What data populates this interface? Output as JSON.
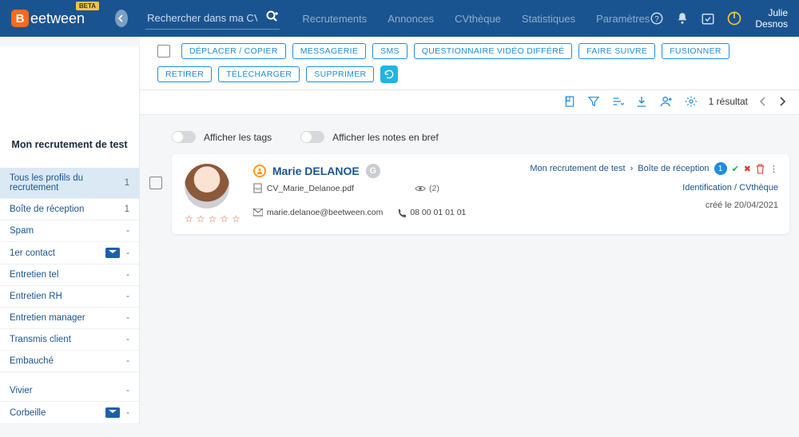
{
  "brand": {
    "word": "eetween",
    "badge_letter": "B",
    "beta": "BETA"
  },
  "search": {
    "placeholder": "Rechercher dans ma CVthèque"
  },
  "nav": {
    "recrut": "Recrutements",
    "annonces": "Annonces",
    "cv": "CVthèque",
    "stats": "Statistiques",
    "params": "Paramètres"
  },
  "user": {
    "first": "Julie",
    "last": "Desnos"
  },
  "actions": {
    "deplacer": "DÉPLACER / COPIER",
    "messagerie": "MESSAGERIE",
    "sms": "SMS",
    "questionnaire": "QUESTIONNAIRE VIDÉO DIFFÉRÉ",
    "suivre": "FAIRE SUIVRE",
    "fusionner": "FUSIONNER",
    "retirer": "RETIRER",
    "telecharger": "TÉLÉCHARGER",
    "supprimer": "SUPPRIMER"
  },
  "resultcount": "1 résultat",
  "sidebar": {
    "title": "Mon recrutement de test",
    "all": {
      "label": "Tous les profils du recrutement",
      "count": "1"
    },
    "inbox": {
      "label": "Boîte de réception",
      "count": "1"
    },
    "spam": {
      "label": "Spam",
      "count": "-"
    },
    "contact1": {
      "label": "1er contact",
      "count": "-"
    },
    "enttel": {
      "label": "Entretien tel",
      "count": "-"
    },
    "entrh": {
      "label": "Entretien RH",
      "count": "-"
    },
    "entmgr": {
      "label": "Entretien manager",
      "count": "-"
    },
    "transmis": {
      "label": "Transmis client",
      "count": "-"
    },
    "embauche": {
      "label": "Embauché",
      "count": "-"
    },
    "vivier": {
      "label": "Vivier",
      "count": "-"
    },
    "corbeille": {
      "label": "Corbeille",
      "count": "-"
    }
  },
  "toggles": {
    "tags": "Afficher les tags",
    "notes": "Afficher les notes en bref"
  },
  "candidate": {
    "name": "Marie DELANOE",
    "cv_file": "CV_Marie_Delanoe.pdf",
    "views": "(2)",
    "email": "marie.delanoe@beetween.com",
    "phone": "08 00 01 01 01",
    "bc_recr": "Mon recrutement de test",
    "bc_stage": "Boîte de réception",
    "bc_count": "1",
    "idcv": "Identification / CVthèque",
    "created": "créé le 20/04/2021"
  }
}
